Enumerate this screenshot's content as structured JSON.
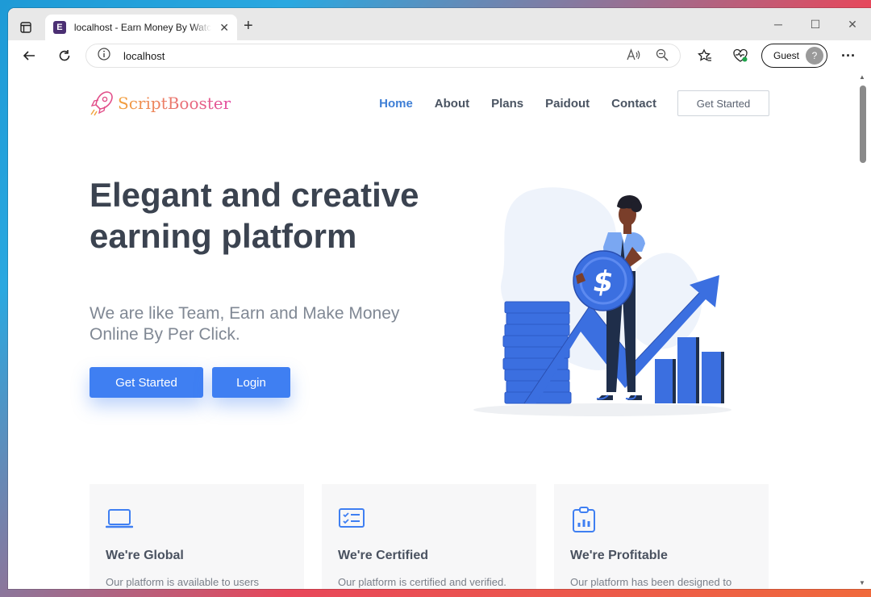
{
  "browser": {
    "tab_title": "localhost - Earn Money By Watching",
    "favicon_letter": "E",
    "url": "localhost",
    "profile_label": "Guest",
    "window_controls": [
      "minimize-icon",
      "maximize-icon",
      "close-icon"
    ]
  },
  "site": {
    "logo_text": "ScriptBooster",
    "nav": [
      {
        "label": "Home",
        "active": true
      },
      {
        "label": "About",
        "active": false
      },
      {
        "label": "Plans",
        "active": false
      },
      {
        "label": "Paidout",
        "active": false
      },
      {
        "label": "Contact",
        "active": false
      }
    ],
    "nav_cta": "Get Started"
  },
  "hero": {
    "title": "Elegant and creative earning platform",
    "subtitle": "We are like Team, Earn and Make Money Online By Per Click.",
    "primary_button": "Get Started",
    "secondary_button": "Login"
  },
  "features": [
    {
      "icon": "laptop-icon",
      "title": "We're Global",
      "text": "Our platform is available to users"
    },
    {
      "icon": "checklist-icon",
      "title": "We're Certified",
      "text": "Our platform is certified and verified."
    },
    {
      "icon": "clipboard-chart-icon",
      "title": "We're Profitable",
      "text": "Our platform has been designed to"
    }
  ],
  "colors": {
    "accent": "#3f7ff2",
    "nav_active": "#3f7fd6",
    "heading": "#3b4350",
    "muted": "#808894"
  }
}
